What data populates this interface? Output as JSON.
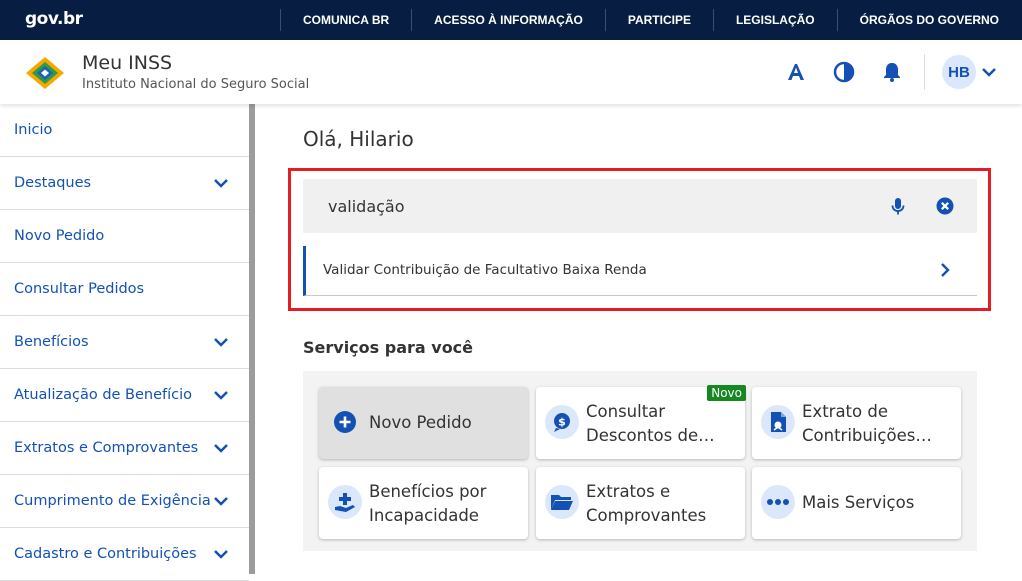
{
  "govbar": {
    "logo": "gov.br",
    "links": [
      "COMUNICA BR",
      "ACESSO À INFORMAÇÃO",
      "PARTICIPE",
      "LEGISLAÇÃO",
      "ÓRGÃOS DO GOVERNO"
    ]
  },
  "header": {
    "title": "Meu INSS",
    "subtitle": "Instituto Nacional do Seguro Social",
    "icons": [
      "font-size-icon",
      "contrast-icon",
      "bell-icon"
    ],
    "avatar_initials": "HB"
  },
  "sidebar": {
    "items": [
      {
        "label": "Inicio",
        "expandable": false
      },
      {
        "label": "Destaques",
        "expandable": true
      },
      {
        "label": "Novo Pedido",
        "expandable": false
      },
      {
        "label": "Consultar Pedidos",
        "expandable": false
      },
      {
        "label": "Benefícios",
        "expandable": true
      },
      {
        "label": "Atualização de Benefício",
        "expandable": true
      },
      {
        "label": "Extratos e Comprovantes",
        "expandable": true
      },
      {
        "label": "Cumprimento de Exigência",
        "expandable": true
      },
      {
        "label": "Cadastro e Contribuições",
        "expandable": true
      }
    ]
  },
  "main": {
    "greeting": "Olá, Hilario",
    "search": {
      "value": "validação"
    },
    "suggestion": "Validar Contribuição de Facultativo Baixa Renda",
    "section_title": "Serviços para você",
    "cards": [
      {
        "lines": [
          "Novo Pedido"
        ],
        "icon": "plus-circle-icon",
        "badge": ""
      },
      {
        "lines": [
          "Consultar",
          "Descontos de…"
        ],
        "icon": "money-icon",
        "badge": "Novo"
      },
      {
        "lines": [
          "Extrato de",
          "Contribuições…"
        ],
        "icon": "document-icon",
        "badge": ""
      },
      {
        "lines": [
          "Benefícios por",
          "Incapacidade"
        ],
        "icon": "hand-plus-icon",
        "badge": ""
      },
      {
        "lines": [
          "Extratos e",
          "Comprovantes"
        ],
        "icon": "folder-icon",
        "badge": ""
      },
      {
        "lines": [
          "Mais Serviços"
        ],
        "icon": "more-icon",
        "badge": ""
      }
    ]
  },
  "colors": {
    "govbar_bg": "#071d41",
    "primary": "#1351b4",
    "highlight": "#e51c23",
    "badge": "#168821"
  }
}
